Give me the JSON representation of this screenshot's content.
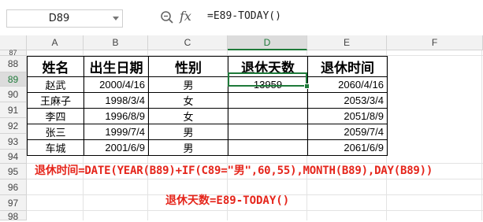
{
  "formula_bar": {
    "name_box": "D89",
    "formula": "=E89-TODAY()",
    "fx_label": "fx"
  },
  "columns": [
    "A",
    "B",
    "C",
    "D",
    "E",
    "F"
  ],
  "rows": [
    "87",
    "88",
    "89",
    "90",
    "91",
    "92",
    "93",
    "94",
    "95",
    "96",
    "97",
    "98"
  ],
  "table": {
    "headers": [
      "姓名",
      "出生日期",
      "性别",
      "退休天数",
      "退休时间"
    ],
    "rows": [
      {
        "name": "赵武",
        "birth": "2000/4/16",
        "gender": "男",
        "days": "13959",
        "retire": "2060/4/16"
      },
      {
        "name": "王麻子",
        "birth": "1998/3/4",
        "gender": "女",
        "days": "",
        "retire": "2053/3/4"
      },
      {
        "name": "李四",
        "birth": "1996/8/9",
        "gender": "女",
        "days": "",
        "retire": "2051/8/9"
      },
      {
        "name": "张三",
        "birth": "1999/7/4",
        "gender": "男",
        "days": "",
        "retire": "2059/7/4"
      },
      {
        "name": "车城",
        "birth": "2001/6/9",
        "gender": "男",
        "days": "",
        "retire": "2061/6/9"
      }
    ]
  },
  "notes": {
    "retire_formula": "退休时间=DATE(YEAR(B89)+IF(C89=\"男\",60,55),MONTH(B89),DAY(B89))",
    "days_formula": "退休天数=E89-TODAY()"
  },
  "colors": {
    "accent": "#1f7a3a",
    "note_red": "#e5251b"
  }
}
